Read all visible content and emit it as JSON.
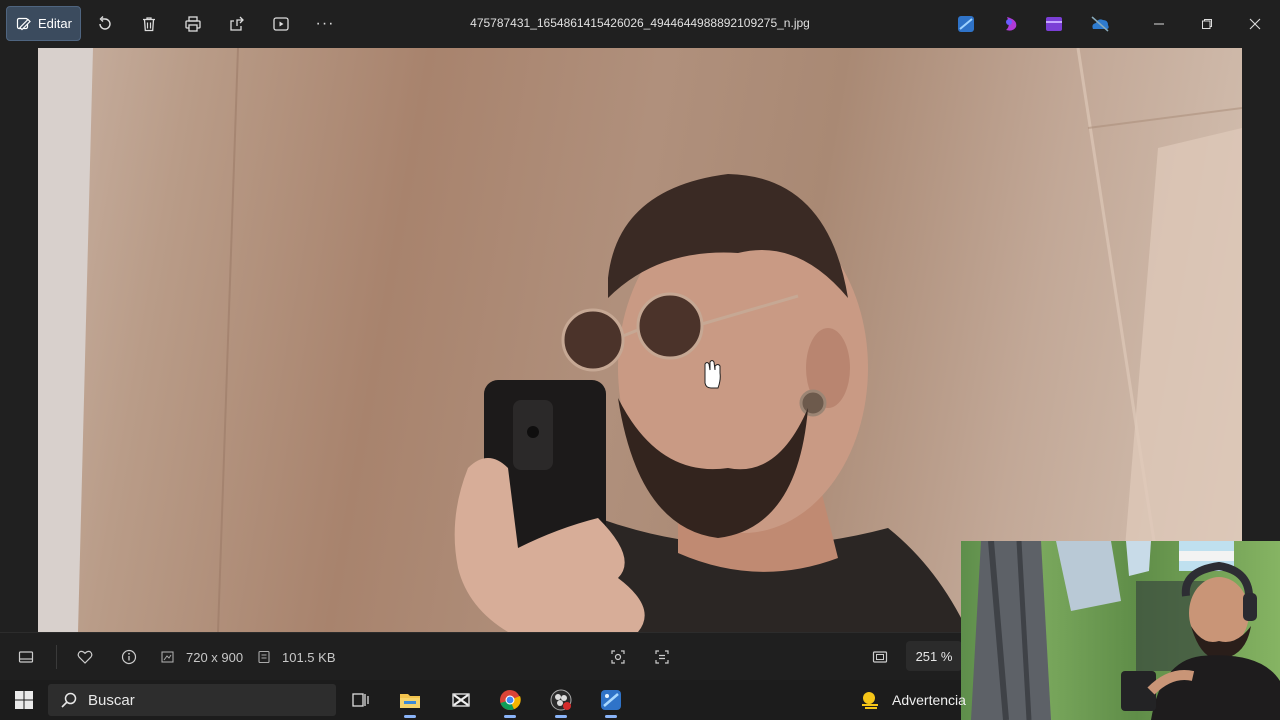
{
  "toolbar": {
    "edit_label": "Editar",
    "filename": "475787431_1654861415426026_4944644988892109275_n.jpg",
    "more_label": "···"
  },
  "status": {
    "dimensions": "720 x 900",
    "size": "101.5 KB",
    "zoom": "251 %"
  },
  "taskbar": {
    "search_label": "Buscar",
    "warning_label": "Advertencia"
  },
  "colors": {
    "accent": "#3b4b5e",
    "background": "#202020",
    "taskbar": "#1c1c1c"
  }
}
